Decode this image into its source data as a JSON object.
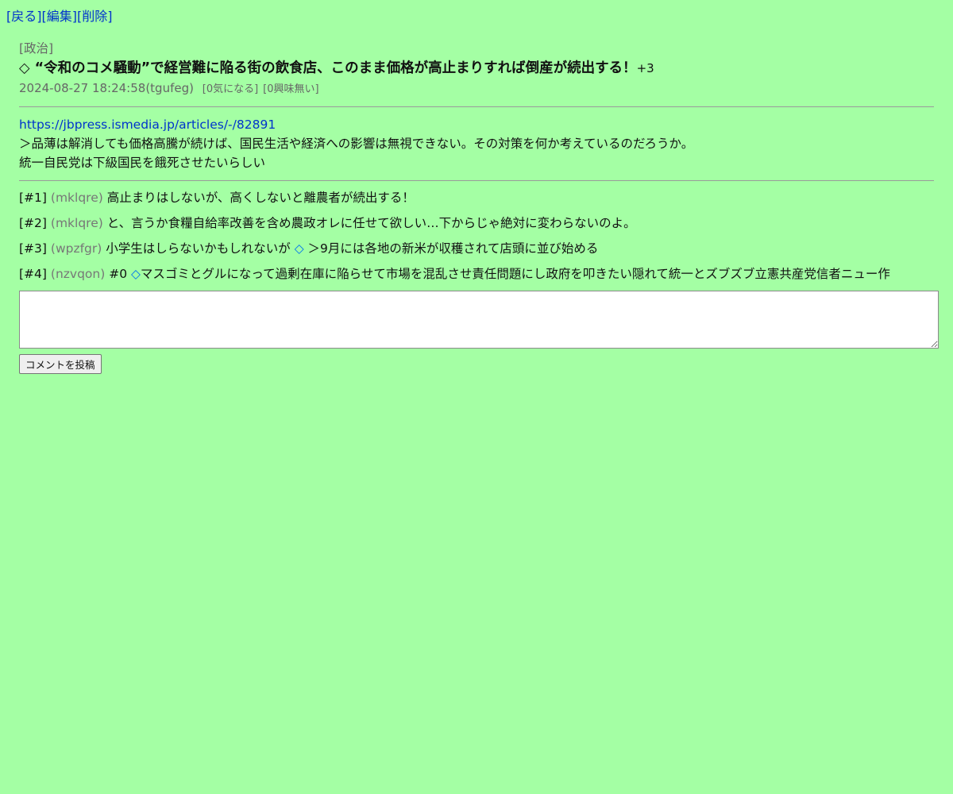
{
  "nav": {
    "back": "[戻る]",
    "edit": "[編集]",
    "delete": "[削除]"
  },
  "post": {
    "category": "[政治]",
    "title_prefix": "◇",
    "title": "“令和のコメ騒動”で経営難に陥る街の飲食店、このまま価格が高止まりすれば倒産が続出する！",
    "score": "+3",
    "datetime": "2024-08-27 18:24:58",
    "author": "(tgufeg)",
    "interest": "[0気になる]",
    "no_interest": "[0興味無い]",
    "link": "https://jbpress.ismedia.jp/articles/-/82891",
    "quote": "＞品薄は解消しても価格高騰が続けば、国民生活や経済への影響は無視できない。その対策を何か考えているのだろうか。",
    "note": "統一自民党は下級国民を餓死させたいらしい"
  },
  "comments": [
    {
      "num": "[#1]",
      "uid": "(mklqre)",
      "pre": "",
      "diamond": "",
      "text": "高止まりはしないが、高くしないと離農者が続出する！"
    },
    {
      "num": "[#2]",
      "uid": "(mklqre)",
      "pre": "",
      "diamond": "",
      "text": "と、言うか食糧自給率改善を含め農政オレに任せて欲しい…下からじゃ絶対に変わらないのよ。"
    },
    {
      "num": "[#3]",
      "uid": "(wpzfgr)",
      "pre": "小学生はしらないかもしれないが ",
      "diamond": "◇",
      "text": " ＞9月には各地の新米が収穫されて店頭に並び始める"
    },
    {
      "num": "[#4]",
      "uid": "(nzvqon)",
      "pre": "#0 ",
      "diamond": "◇",
      "text": "マスゴミとグルになって過剰在庫に陥らせて市場を混乱させ責任問題にし政府を叩きたい隠れて統一とズブズブ立憲共産党信者ニュー作"
    }
  ],
  "form": {
    "textarea_value": "",
    "submit_label": "コメントを投稿"
  },
  "colors": {
    "background": "#a4ffa4",
    "link": "#0033cc",
    "muted": "#666666",
    "diamond": "#0077ee"
  }
}
